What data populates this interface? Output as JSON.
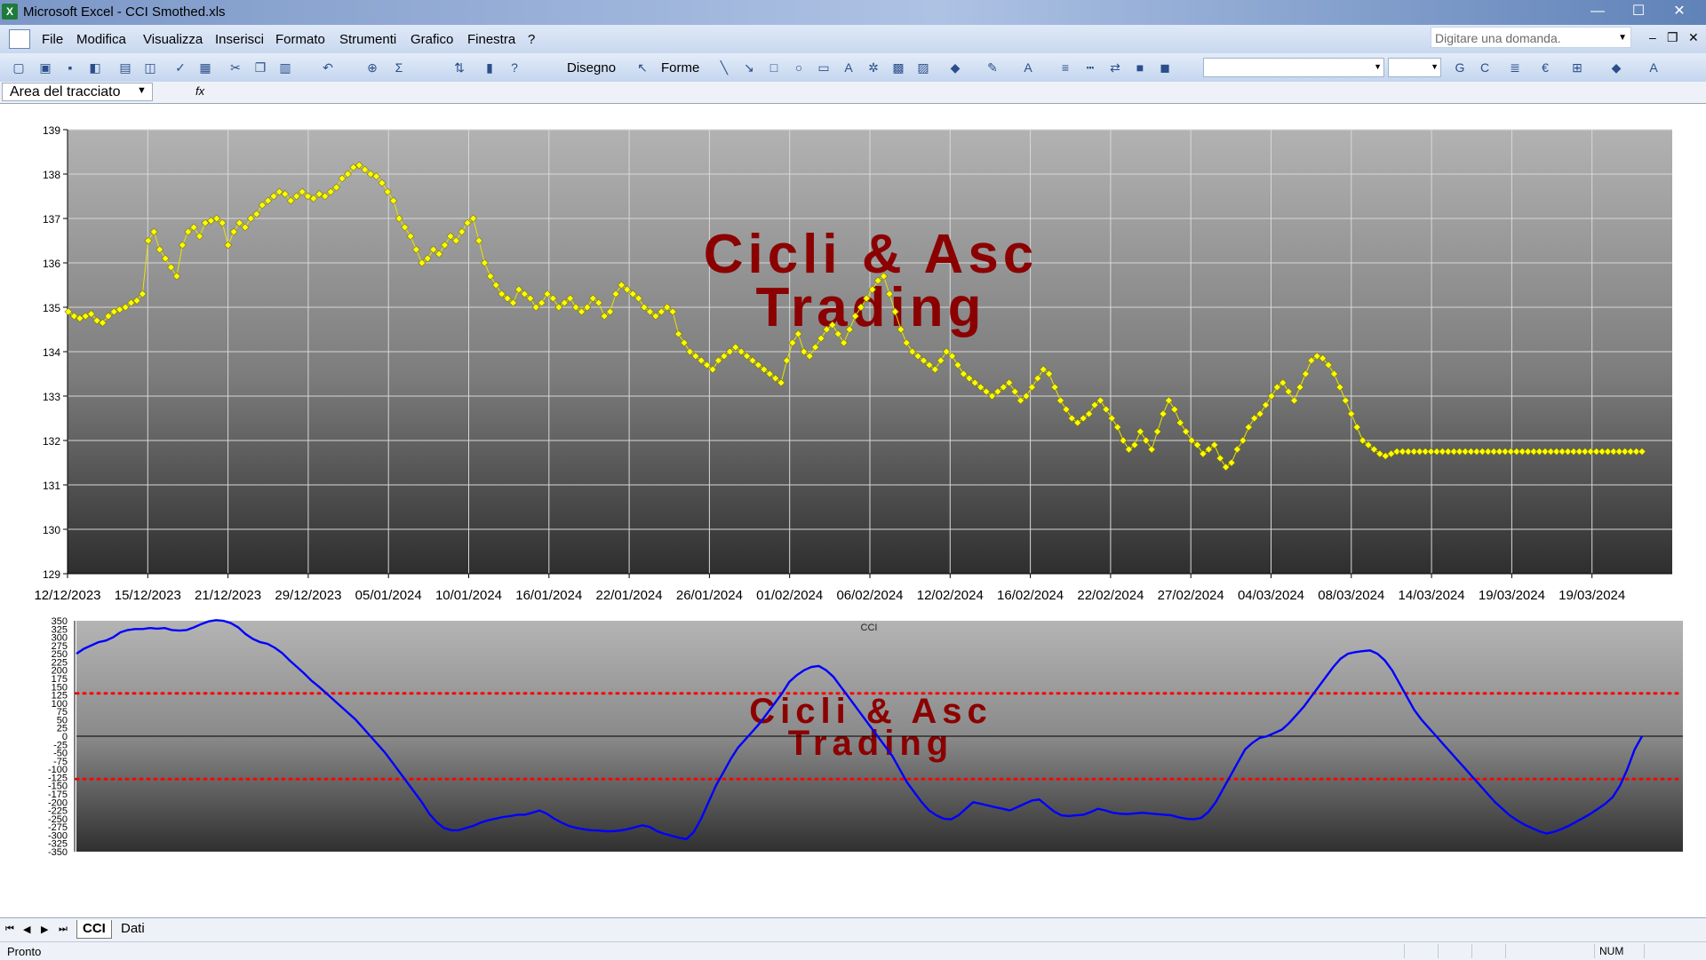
{
  "window": {
    "title": "Microsoft Excel - CCI Smothed.xls",
    "app_icon": "excel-icon",
    "min": "—",
    "max": "☐",
    "close": "✕"
  },
  "menu": {
    "items": [
      "File",
      "Modifica",
      "Visualizza",
      "Inserisci",
      "Formato",
      "Strumenti",
      "Grafico",
      "Finestra",
      "?"
    ],
    "ask_placeholder": "Digitare una domanda.",
    "doc_min": "–",
    "doc_restore": "❐",
    "doc_close": "✕"
  },
  "toolbar": {
    "draw_label": "Disegno",
    "shapes_label": "Forme",
    "font_g": "G",
    "font_c": "C",
    "euro": "€"
  },
  "namebox": {
    "value": "Area del tracciato"
  },
  "sheet_tabs": [
    "CCI",
    "Dati"
  ],
  "status": {
    "left": "Pronto",
    "num": "NUM"
  },
  "watermark": {
    "line1": "Cicli & Asc",
    "line2": "Trading"
  },
  "chart_data": [
    {
      "type": "line",
      "title": "",
      "ylim": [
        129,
        139
      ],
      "yticks": [
        129,
        130,
        131,
        132,
        133,
        134,
        135,
        136,
        137,
        138,
        139
      ],
      "xtick_labels": [
        "12/12/2023",
        "15/12/2023",
        "21/12/2023",
        "29/12/2023",
        "05/01/2024",
        "10/01/2024",
        "16/01/2024",
        "22/01/2024",
        "26/01/2024",
        "01/02/2024",
        "06/02/2024",
        "12/02/2024",
        "16/02/2024",
        "22/02/2024",
        "27/02/2024",
        "04/03/2024",
        "08/03/2024",
        "14/03/2024",
        "19/03/2024",
        "19/03/2024"
      ],
      "grid": true,
      "marker_color": "#ffff00",
      "series": [
        {
          "values": [
            134.9,
            134.8,
            134.75,
            134.8,
            134.85,
            134.7,
            134.65,
            134.8,
            134.9,
            134.95,
            135.0,
            135.1,
            135.15,
            135.3,
            136.5,
            136.7,
            136.3,
            136.1,
            135.9,
            135.7,
            136.4,
            136.7,
            136.8,
            136.6,
            136.9,
            136.95,
            137.0,
            136.9,
            136.4,
            136.7,
            136.9,
            136.8,
            137.0,
            137.1,
            137.3,
            137.4,
            137.5,
            137.6,
            137.55,
            137.4,
            137.5,
            137.6,
            137.5,
            137.45,
            137.55,
            137.5,
            137.6,
            137.7,
            137.9,
            138.0,
            138.15,
            138.2,
            138.1,
            138.0,
            137.95,
            137.8,
            137.6,
            137.4,
            137.0,
            136.8,
            136.6,
            136.3,
            136.0,
            136.1,
            136.3,
            136.2,
            136.4,
            136.6,
            136.5,
            136.7,
            136.9,
            137.0,
            136.5,
            136.0,
            135.7,
            135.5,
            135.3,
            135.2,
            135.1,
            135.4,
            135.3,
            135.2,
            135.0,
            135.1,
            135.3,
            135.2,
            135.0,
            135.1,
            135.2,
            135.0,
            134.9,
            135.0,
            135.2,
            135.1,
            134.8,
            134.9,
            135.3,
            135.5,
            135.4,
            135.3,
            135.2,
            135.0,
            134.9,
            134.8,
            134.9,
            135.0,
            134.9,
            134.4,
            134.2,
            134.0,
            133.9,
            133.8,
            133.7,
            133.6,
            133.8,
            133.9,
            134.0,
            134.1,
            134.0,
            133.9,
            133.8,
            133.7,
            133.6,
            133.5,
            133.4,
            133.3,
            133.8,
            134.2,
            134.4,
            134.0,
            133.9,
            134.1,
            134.3,
            134.5,
            134.6,
            134.4,
            134.2,
            134.5,
            134.8,
            135.0,
            135.2,
            135.4,
            135.6,
            135.7,
            135.3,
            134.9,
            134.5,
            134.2,
            134.0,
            133.9,
            133.8,
            133.7,
            133.6,
            133.8,
            134.0,
            133.9,
            133.7,
            133.5,
            133.4,
            133.3,
            133.2,
            133.1,
            133.0,
            133.1,
            133.2,
            133.3,
            133.1,
            132.9,
            133.0,
            133.2,
            133.4,
            133.6,
            133.5,
            133.2,
            132.9,
            132.7,
            132.5,
            132.4,
            132.5,
            132.6,
            132.8,
            132.9,
            132.7,
            132.5,
            132.3,
            132.0,
            131.8,
            131.9,
            132.2,
            132.0,
            131.8,
            132.2,
            132.6,
            132.9,
            132.7,
            132.4,
            132.2,
            132.0,
            131.9,
            131.7,
            131.8,
            131.9,
            131.6,
            131.4,
            131.5,
            131.8,
            132.0,
            132.3,
            132.5,
            132.6,
            132.8,
            133.0,
            133.2,
            133.3,
            133.1,
            132.9,
            133.2,
            133.5,
            133.8,
            133.9,
            133.85,
            133.7,
            133.5,
            133.2,
            132.9,
            132.6,
            132.3,
            132.0,
            131.9,
            131.8,
            131.7,
            131.65,
            131.7,
            131.75,
            131.75,
            131.75,
            131.75,
            131.75,
            131.75,
            131.75,
            131.75,
            131.75,
            131.75,
            131.75,
            131.75,
            131.75,
            131.75,
            131.75,
            131.75,
            131.75,
            131.75,
            131.75,
            131.75,
            131.75,
            131.75,
            131.75,
            131.75,
            131.75,
            131.75,
            131.75,
            131.75,
            131.75,
            131.75,
            131.75,
            131.75,
            131.75,
            131.75,
            131.75,
            131.75,
            131.75,
            131.75,
            131.75,
            131.75,
            131.75,
            131.75,
            131.75,
            131.75
          ]
        }
      ]
    },
    {
      "type": "line",
      "title": "CCI",
      "ylim": [
        -350,
        350
      ],
      "yticks": [
        350,
        325,
        300,
        275,
        250,
        225,
        200,
        175,
        150,
        125,
        100,
        75,
        50,
        25,
        0,
        -25,
        -50,
        -75,
        -100,
        -125,
        -150,
        -175,
        -200,
        -225,
        -250,
        -275,
        -300,
        -325,
        -350
      ],
      "thresholds": [
        130,
        -130
      ],
      "threshold_color": "#ff0000",
      "line_color": "#0000ff",
      "series": [
        {
          "values": [
            250,
            265,
            275,
            285,
            290,
            300,
            315,
            322,
            325,
            325,
            328,
            326,
            328,
            322,
            320,
            322,
            330,
            340,
            348,
            352,
            350,
            343,
            330,
            310,
            295,
            285,
            280,
            268,
            252,
            230,
            210,
            190,
            168,
            150,
            130,
            110,
            90,
            70,
            50,
            25,
            0,
            -25,
            -50,
            -80,
            -110,
            -140,
            -170,
            -200,
            -235,
            -260,
            -278,
            -285,
            -285,
            -278,
            -272,
            -262,
            -255,
            -250,
            -245,
            -242,
            -238,
            -238,
            -232,
            -225,
            -235,
            -250,
            -262,
            -272,
            -278,
            -282,
            -285,
            -286,
            -288,
            -288,
            -286,
            -282,
            -276,
            -270,
            -275,
            -288,
            -296,
            -302,
            -308,
            -312,
            -290,
            -250,
            -200,
            -150,
            -110,
            -70,
            -35,
            -10,
            15,
            40,
            70,
            100,
            130,
            165,
            185,
            200,
            210,
            213,
            200,
            180,
            150,
            120,
            90,
            60,
            30,
            0,
            -30,
            -60,
            -100,
            -140,
            -170,
            -200,
            -225,
            -240,
            -250,
            -252,
            -240,
            -220,
            -200,
            -205,
            -210,
            -215,
            -220,
            -225,
            -215,
            -205,
            -195,
            -192,
            -210,
            -228,
            -240,
            -242,
            -240,
            -238,
            -230,
            -220,
            -225,
            -232,
            -235,
            -236,
            -234,
            -232,
            -234,
            -236,
            -238,
            -240,
            -246,
            -250,
            -252,
            -248,
            -230,
            -200,
            -160,
            -120,
            -80,
            -40,
            -20,
            -5,
            0,
            10,
            20,
            40,
            65,
            90,
            120,
            150,
            180,
            210,
            235,
            250,
            255,
            258,
            260,
            250,
            230,
            200,
            160,
            120,
            80,
            50,
            25,
            0,
            -25,
            -50,
            -75,
            -100,
            -125,
            -150,
            -175,
            -200,
            -220,
            -240,
            -255,
            -268,
            -278,
            -288,
            -295,
            -290,
            -282,
            -272,
            -260,
            -248,
            -235,
            -220,
            -205,
            -185,
            -150,
            -100,
            -40,
            0
          ]
        }
      ]
    }
  ]
}
